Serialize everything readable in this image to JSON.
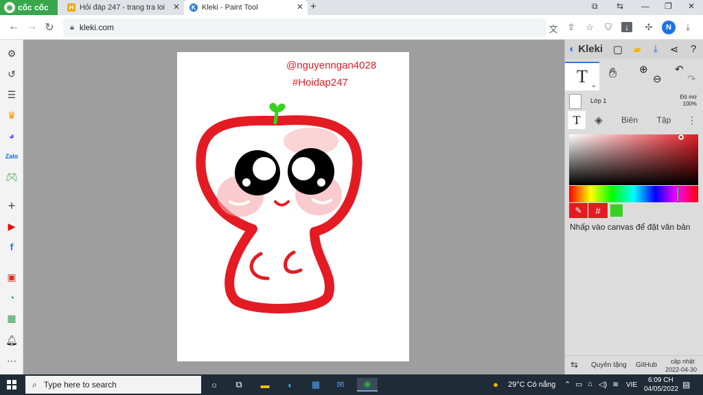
{
  "browser": {
    "brand": "cốc cốc",
    "tabs": [
      {
        "title": "Hỏi đáp 247 - trang tra loi",
        "favicon": "H"
      },
      {
        "title": "Kleki - Paint Tool",
        "favicon": "K"
      }
    ],
    "url": "kleki.com",
    "profile_initial": "N"
  },
  "sidebar_icons": [
    "settings-icon",
    "history-icon",
    "list-icon",
    "crown-icon",
    "messenger-icon",
    "zalo-icon",
    "gamepad-icon",
    "plus-icon",
    "youtube-icon",
    "facebook-icon",
    "app-icon",
    "chat-icon",
    "table-icon",
    "bell-icon",
    "more-icon"
  ],
  "canvas": {
    "watermark_user": "@nguyenngan4028",
    "watermark_tag": "#Hoidap247",
    "text_color": "#e41b23",
    "drawing_color": "#e41b23",
    "sprout_color": "#38d11f"
  },
  "kleki": {
    "logo": "Kleki",
    "layer_name": "Lớp 1",
    "opacity_label": "Độ mờ",
    "opacity_value": "100%",
    "tab_edit": "Biên",
    "tab_file": "Tập",
    "hex_label": "#",
    "primary_color": "#e41b23",
    "secondary_color": "#38d11f",
    "hint": "Nhấp vào canvas để đặt văn bản",
    "footer": {
      "donate": "Quyên tặng",
      "github": "GitHub",
      "update_label": "cập nhật",
      "update_date": "2022-04-30"
    }
  },
  "taskbar": {
    "search_placeholder": "Type here to search",
    "weather": "29°C Có nắng",
    "language": "VIE",
    "time": "6:09 CH",
    "date": "04/05/2022"
  }
}
